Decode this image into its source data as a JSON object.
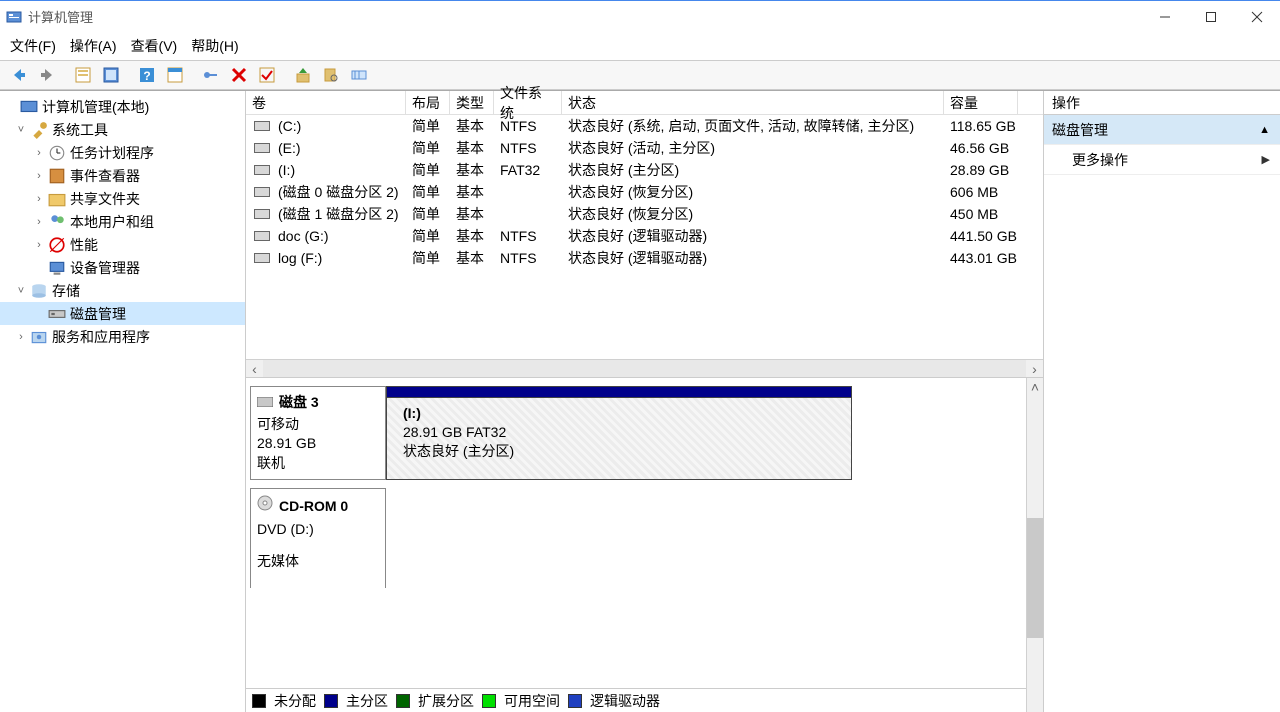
{
  "title": "计算机管理",
  "menu": {
    "file": "文件(F)",
    "action": "操作(A)",
    "view": "查看(V)",
    "help": "帮助(H)"
  },
  "tree": {
    "root": "计算机管理(本地)",
    "systools": "系统工具",
    "taskscheduler": "任务计划程序",
    "eventviewer": "事件查看器",
    "sharedfolders": "共享文件夹",
    "localusers": "本地用户和组",
    "performance": "性能",
    "devmgr": "设备管理器",
    "storage": "存储",
    "diskmgmt": "磁盘管理",
    "services": "服务和应用程序"
  },
  "volumes": {
    "cols": {
      "name": "卷",
      "layout": "布局",
      "type": "类型",
      "fs": "文件系统",
      "status": "状态",
      "cap": "容量"
    },
    "rows": [
      {
        "name": "(C:)",
        "layout": "简单",
        "type": "基本",
        "fs": "NTFS",
        "status": "状态良好 (系统, 启动, 页面文件, 活动, 故障转储, 主分区)",
        "cap": "118.65 GB"
      },
      {
        "name": "(E:)",
        "layout": "简单",
        "type": "基本",
        "fs": "NTFS",
        "status": "状态良好 (活动, 主分区)",
        "cap": "46.56 GB"
      },
      {
        "name": "(I:)",
        "layout": "简单",
        "type": "基本",
        "fs": "FAT32",
        "status": "状态良好 (主分区)",
        "cap": "28.89 GB"
      },
      {
        "name": "(磁盘 0 磁盘分区 2)",
        "layout": "简单",
        "type": "基本",
        "fs": "",
        "status": "状态良好 (恢复分区)",
        "cap": "606 MB"
      },
      {
        "name": "(磁盘 1 磁盘分区 2)",
        "layout": "简单",
        "type": "基本",
        "fs": "",
        "status": "状态良好 (恢复分区)",
        "cap": "450 MB"
      },
      {
        "name": "doc (G:)",
        "layout": "简单",
        "type": "基本",
        "fs": "NTFS",
        "status": "状态良好 (逻辑驱动器)",
        "cap": "441.50 GB"
      },
      {
        "name": "log (F:)",
        "layout": "简单",
        "type": "基本",
        "fs": "NTFS",
        "status": "状态良好 (逻辑驱动器)",
        "cap": "443.01 GB"
      }
    ]
  },
  "graphical": {
    "disk3": {
      "title": "磁盘 3",
      "line1": "可移动",
      "line2": "28.91 GB",
      "line3": "联机",
      "part": {
        "name": "(I:)",
        "size": "28.91 GB FAT32",
        "status": "状态良好 (主分区)"
      }
    },
    "cdrom": {
      "title": "CD-ROM 0",
      "line1": "DVD (D:)",
      "line2": "无媒体"
    }
  },
  "legend": {
    "unalloc": "未分配",
    "primary": "主分区",
    "extended": "扩展分区",
    "free": "可用空间",
    "logical": "逻辑驱动器"
  },
  "actions": {
    "header": "操作",
    "item1": "磁盘管理",
    "item2": "更多操作"
  }
}
